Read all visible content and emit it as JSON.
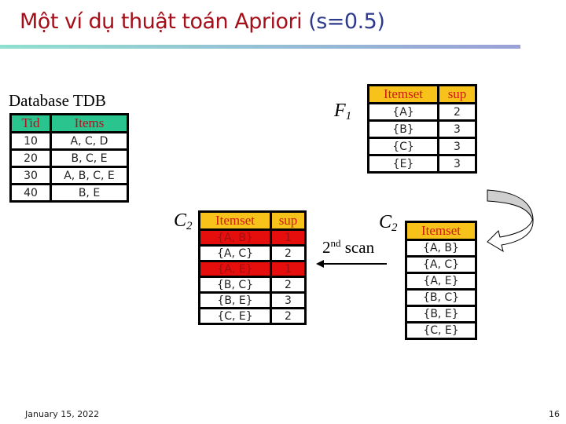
{
  "slide": {
    "title_main": "Một ví dụ thuật toán Apriori",
    "title_param": "(s=0.5)",
    "footer_date": "January 15, 2022",
    "page_number": "16"
  },
  "colors": {
    "title": "#a50f1a",
    "title_param": "#2e3a8c",
    "tdb_header": "#2ac48e",
    "itemset_header": "#f7c21a",
    "pruned_row": "#e60d0d"
  },
  "tdb": {
    "label": "Database TDB",
    "headers": [
      "Tid",
      "Items"
    ],
    "rows": [
      [
        "10",
        "A, C, D"
      ],
      [
        "20",
        "B, C, E"
      ],
      [
        "30",
        "A, B, C, E"
      ],
      [
        "40",
        "B, E"
      ]
    ]
  },
  "f1": {
    "label_var": "F",
    "label_sub": "1",
    "headers": [
      "Itemset",
      "sup"
    ],
    "rows": [
      [
        "{A}",
        "2"
      ],
      [
        "{B}",
        "3"
      ],
      [
        "{C}",
        "3"
      ],
      [
        "{E}",
        "3"
      ]
    ]
  },
  "c2_counted": {
    "label_var": "C",
    "label_sub": "2",
    "headers": [
      "Itemset",
      "sup"
    ],
    "rows": [
      {
        "itemset": "{A, B}",
        "sup": "1",
        "pruned": true
      },
      {
        "itemset": "{A, C}",
        "sup": "2",
        "pruned": false
      },
      {
        "itemset": "{A, E}",
        "sup": "1",
        "pruned": true
      },
      {
        "itemset": "{B, C}",
        "sup": "2",
        "pruned": false
      },
      {
        "itemset": "{B, E}",
        "sup": "3",
        "pruned": false
      },
      {
        "itemset": "{C, E}",
        "sup": "2",
        "pruned": false
      }
    ]
  },
  "c2_candidates": {
    "label_var": "C",
    "label_sub": "2",
    "headers": [
      "Itemset"
    ],
    "rows": [
      "{A, B}",
      "{A, C}",
      "{A, E}",
      "{B, C}",
      "{B, E}",
      "{C, E}"
    ]
  },
  "scan": {
    "ordinal": "2",
    "suffix": "nd",
    "word": "scan"
  },
  "icons": {
    "curved_arrow": "curved-arrow-icon",
    "left_arrow": "left-arrow-icon"
  }
}
